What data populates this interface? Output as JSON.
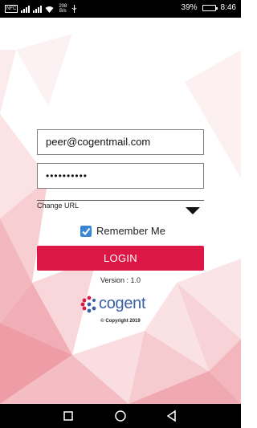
{
  "status_bar": {
    "nfc": "NFC",
    "net_speed": "208 B/s",
    "battery": "39%",
    "battery_level": 0.39,
    "time": "8:46"
  },
  "login_form": {
    "email_value": "peer@cogentmail.com",
    "password_masked": "••••••••••",
    "change_url_label": "Change URL",
    "remember_me_label": "Remember Me",
    "remember_me_checked": true,
    "login_button_label": "LOGIN"
  },
  "footer": {
    "version": "Version : 1.0",
    "logo_text": "cogent",
    "copyright": "© Copyright 2019"
  },
  "colors": {
    "accent": "#dc1745",
    "checkbox": "#3a86d4",
    "brand_blue": "#3a5fa8",
    "background_pink": "#f7c9ce"
  }
}
